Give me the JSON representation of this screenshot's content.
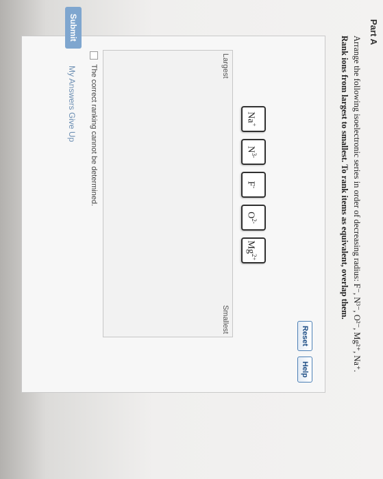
{
  "part_title": "Part A",
  "instruction": "Arrange the following isoelectronic series in order of decreasing radius: F⁻, N³⁻, O²⁻, Mg²⁺, Na⁺.",
  "instruction_bold": "Rank ions from largest to smallest. To rank items as equivalent, overlap them.",
  "buttons": {
    "reset": "Reset",
    "help": "Help",
    "submit": "Submit"
  },
  "ions": [
    {
      "symbol": "Na",
      "charge": "+"
    },
    {
      "symbol": "N",
      "charge": "3-"
    },
    {
      "symbol": "F",
      "charge": "-"
    },
    {
      "symbol": "O",
      "charge": "2-"
    },
    {
      "symbol": "Mg",
      "charge": "2+"
    }
  ],
  "ranking": {
    "largest": "Largest",
    "smallest": "Smallest"
  },
  "cannot_label": "The correct ranking cannot be determined.",
  "links": "My Answers  Give Up"
}
